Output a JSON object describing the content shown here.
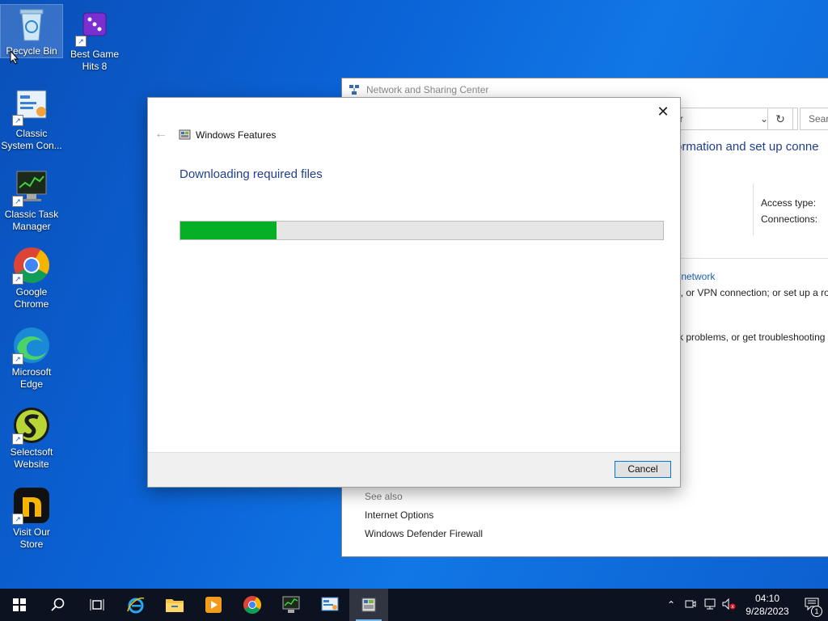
{
  "desktop": {
    "icons": [
      {
        "label": "Recycle Bin"
      },
      {
        "label": "Best Game Hits 8"
      },
      {
        "label": "Classic System Con..."
      },
      {
        "label": "Classic Task Manager"
      },
      {
        "label": "Google Chrome"
      },
      {
        "label": "Microsoft Edge"
      },
      {
        "label": "Selectsoft Website"
      },
      {
        "label": "Visit Our Store"
      }
    ]
  },
  "background_window": {
    "title": "Network and Sharing Center",
    "address_text": "er",
    "search_placeholder": "Sear",
    "heading": "ormation and set up conne",
    "access_type_label": "Access type:",
    "connections_label": "Connections:",
    "link_network": "r network",
    "text_vpn": "o, or VPN connection; or set up a ro",
    "text_troubleshoot": "rk problems, or get troubleshooting",
    "see_also": "See also",
    "see_also_items": [
      "Internet Options",
      "Windows Defender Firewall"
    ]
  },
  "dialog": {
    "title": "Windows Features",
    "message": "Downloading required files",
    "progress": 0.2,
    "cancel_label": "Cancel"
  },
  "taskbar": {
    "time": "04:10",
    "date": "9/28/2023",
    "notification_count": "1"
  }
}
